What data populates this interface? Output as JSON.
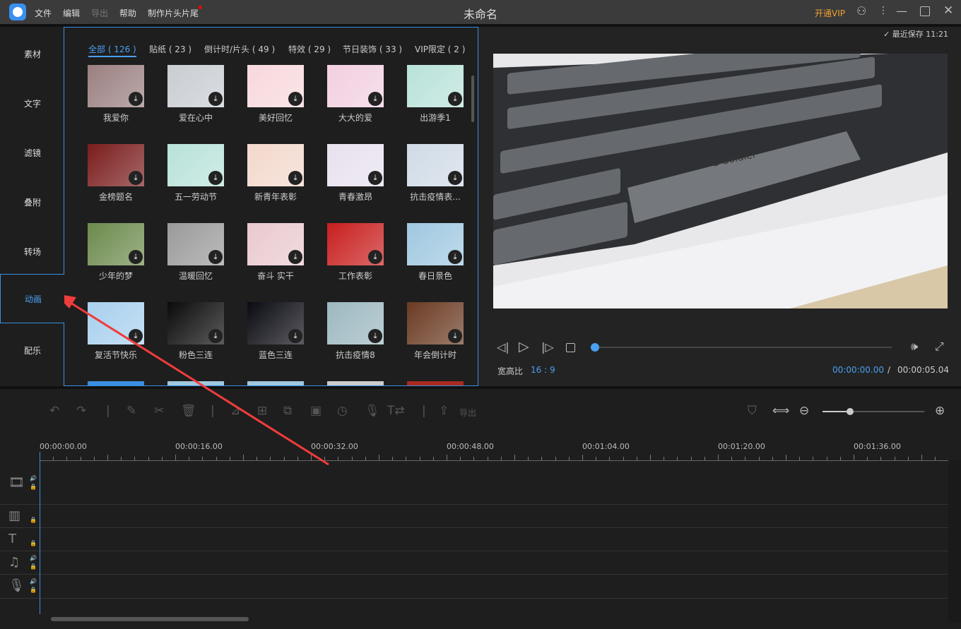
{
  "titlebar": {
    "menus": [
      "文件",
      "编辑",
      "导出",
      "帮助",
      "制作片头片尾"
    ],
    "title": "未命名",
    "vip": "开通VIP",
    "icons": [
      "user-icon",
      "more-icon",
      "minimize-icon",
      "maximize-icon",
      "close-icon"
    ]
  },
  "nav": {
    "items": [
      "素材",
      "文字",
      "滤镜",
      "叠附",
      "转场",
      "动画",
      "配乐"
    ],
    "active": "动画"
  },
  "categories": [
    "全部 ( 126 )",
    "贴纸 ( 23 )",
    "倒计时/片头 ( 49 )",
    "特效 ( 29 )",
    "节日装饰 ( 33 )",
    "VIP限定 ( 2 )"
  ],
  "templates": [
    {
      "name": "我爱你",
      "color": "#9a7f80"
    },
    {
      "name": "爱在心中",
      "color": "#c8cdd2"
    },
    {
      "name": "美好回忆",
      "color": "#f8d8dc"
    },
    {
      "name": "大大的爱",
      "color": "#f2cfe0"
    },
    {
      "name": "出游季1",
      "color": "#b8e2d8"
    },
    {
      "name": "金榜题名",
      "color": "#7a1c1c"
    },
    {
      "name": "五一劳动节",
      "color": "#b8e2d8"
    },
    {
      "name": "新青年表彰",
      "color": "#f3d8cc"
    },
    {
      "name": "青春激昂",
      "color": "#e7e1ee"
    },
    {
      "name": "抗击疫情表...",
      "color": "#d0dbe6"
    },
    {
      "name": "少年的梦",
      "color": "#6c8a4c"
    },
    {
      "name": "温暖回忆",
      "color": "#9a9a9a"
    },
    {
      "name": "奋斗 实干",
      "color": "#e9c9cf"
    },
    {
      "name": "工作表彰",
      "color": "#c81e1e"
    },
    {
      "name": "春日景色",
      "color": "#9fc8e0"
    },
    {
      "name": "复活节快乐",
      "color": "#a8d0ee"
    },
    {
      "name": "粉色三连",
      "color": "#0a0a0a"
    },
    {
      "name": "蓝色三连",
      "color": "#0a0a12"
    },
    {
      "name": "抗击疫情8",
      "color": "#9cb8c0"
    },
    {
      "name": "年会倒计时",
      "color": "#6a3a22"
    }
  ],
  "partial_row_colors": [
    "#3a8fe0",
    "#9fc8e0",
    "#9fc8e0",
    "#ccc",
    "#a82a1e"
  ],
  "preview": {
    "saved": "最近保存 11:21",
    "aspect_label": "宽高比",
    "aspect": "16 : 9",
    "current_time": "00:00:00.00",
    "separator": "/",
    "total_time": "00:00:05.04",
    "keyboard_text": "G-Soldier"
  },
  "toolbar": {
    "export": "导出"
  },
  "timeline": {
    "ticks": [
      "00:00:00.00",
      "00:00:16.00",
      "00:00:32.00",
      "00:00:48.00",
      "00:01:04.00",
      "00:01:20.00",
      "00:01:36.00"
    ],
    "tracks": [
      "video-track-icon",
      "overlay-track-icon",
      "text-track-icon",
      "music-track-icon",
      "voice-track-icon"
    ]
  },
  "annotation_color": "#f03c3c"
}
